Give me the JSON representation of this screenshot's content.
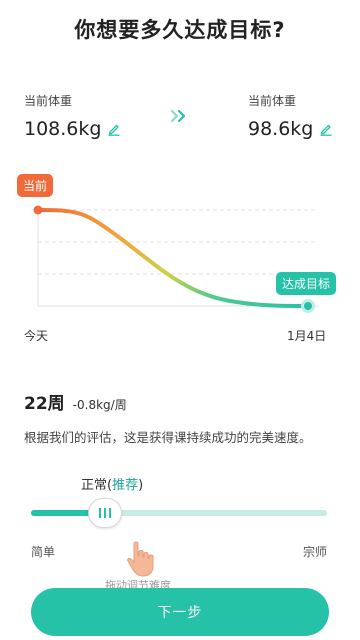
{
  "header": {
    "title": "你想要多久达成目标?"
  },
  "current": {
    "label": "当前体重",
    "value": "108.6kg"
  },
  "target": {
    "label": "当前体重",
    "value": "98.6kg"
  },
  "chart": {
    "start_tag": "当前",
    "goal_tag": "达成目标",
    "x_start": "今天",
    "x_end": "1月4日"
  },
  "chart_data": {
    "type": "line",
    "x": [
      "今天",
      "1月4日"
    ],
    "series": [
      {
        "values": [
          108.6,
          98.6
        ]
      }
    ],
    "annotations": [
      "当前",
      "达成目标"
    ]
  },
  "plan": {
    "weeks": "22周",
    "rate": "-0.8kg/周",
    "description": "根据我们的评估，这是获得课持续成功的完美速度。"
  },
  "speed": {
    "label": "正常(",
    "recommend": "推荐",
    "close": ")",
    "level": 0.25,
    "min_label": "简单",
    "max_label": "宗师",
    "hint": "拖动调节难度"
  },
  "colors": {
    "accent": "#26c2a8",
    "start": "#f06a3a"
  },
  "footer": {
    "next_label": "下一步"
  }
}
